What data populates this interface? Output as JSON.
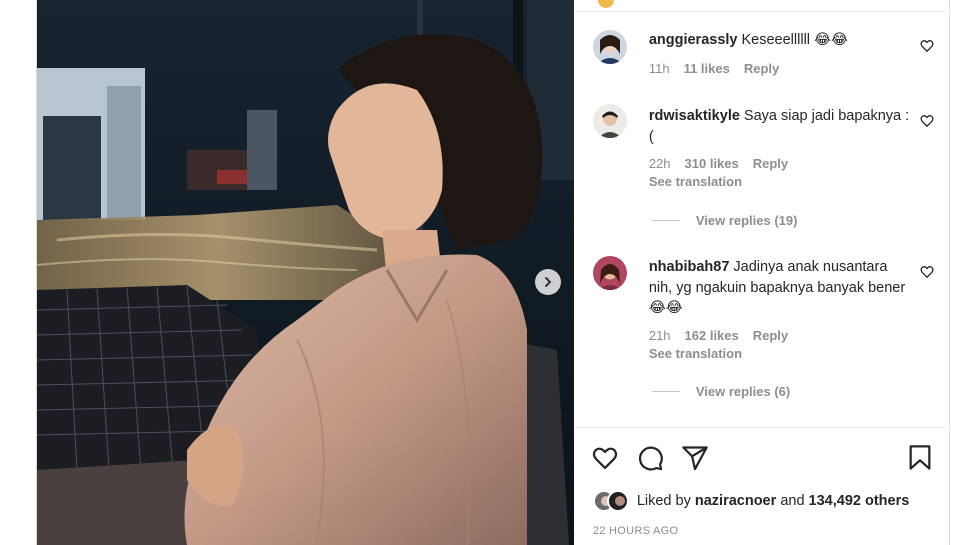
{
  "comments": [
    {
      "username": "anggierassly",
      "text": "Keseeellllll 😂😂",
      "time": "11h",
      "likes": "11 likes",
      "reply_label": "Reply"
    },
    {
      "username": "rdwisaktikyle",
      "text": "Saya siap jadi bapaknya :(",
      "time": "22h",
      "likes": "310 likes",
      "reply_label": "Reply",
      "see_translation": "See translation",
      "view_replies": "View replies (19)"
    },
    {
      "username": "nhabibah87",
      "text": "Jadinya anak nusantara nih, yg ngakuin bapaknya banyak bener 😂😂",
      "time": "21h",
      "likes": "162 likes",
      "reply_label": "Reply",
      "see_translation": "See translation",
      "view_replies": "View replies (6)"
    }
  ],
  "footer": {
    "liked_by_prefix": "Liked by",
    "liked_by_user": "naziracnoer",
    "liked_by_conj": "and",
    "liked_by_count": "134,492 others",
    "timestamp": "22 HOURS AGO"
  },
  "icons": {
    "like": "heart-icon",
    "comment": "comment-bubble-icon",
    "share": "paper-plane-icon",
    "save": "bookmark-icon",
    "next": "chevron-right-icon"
  }
}
